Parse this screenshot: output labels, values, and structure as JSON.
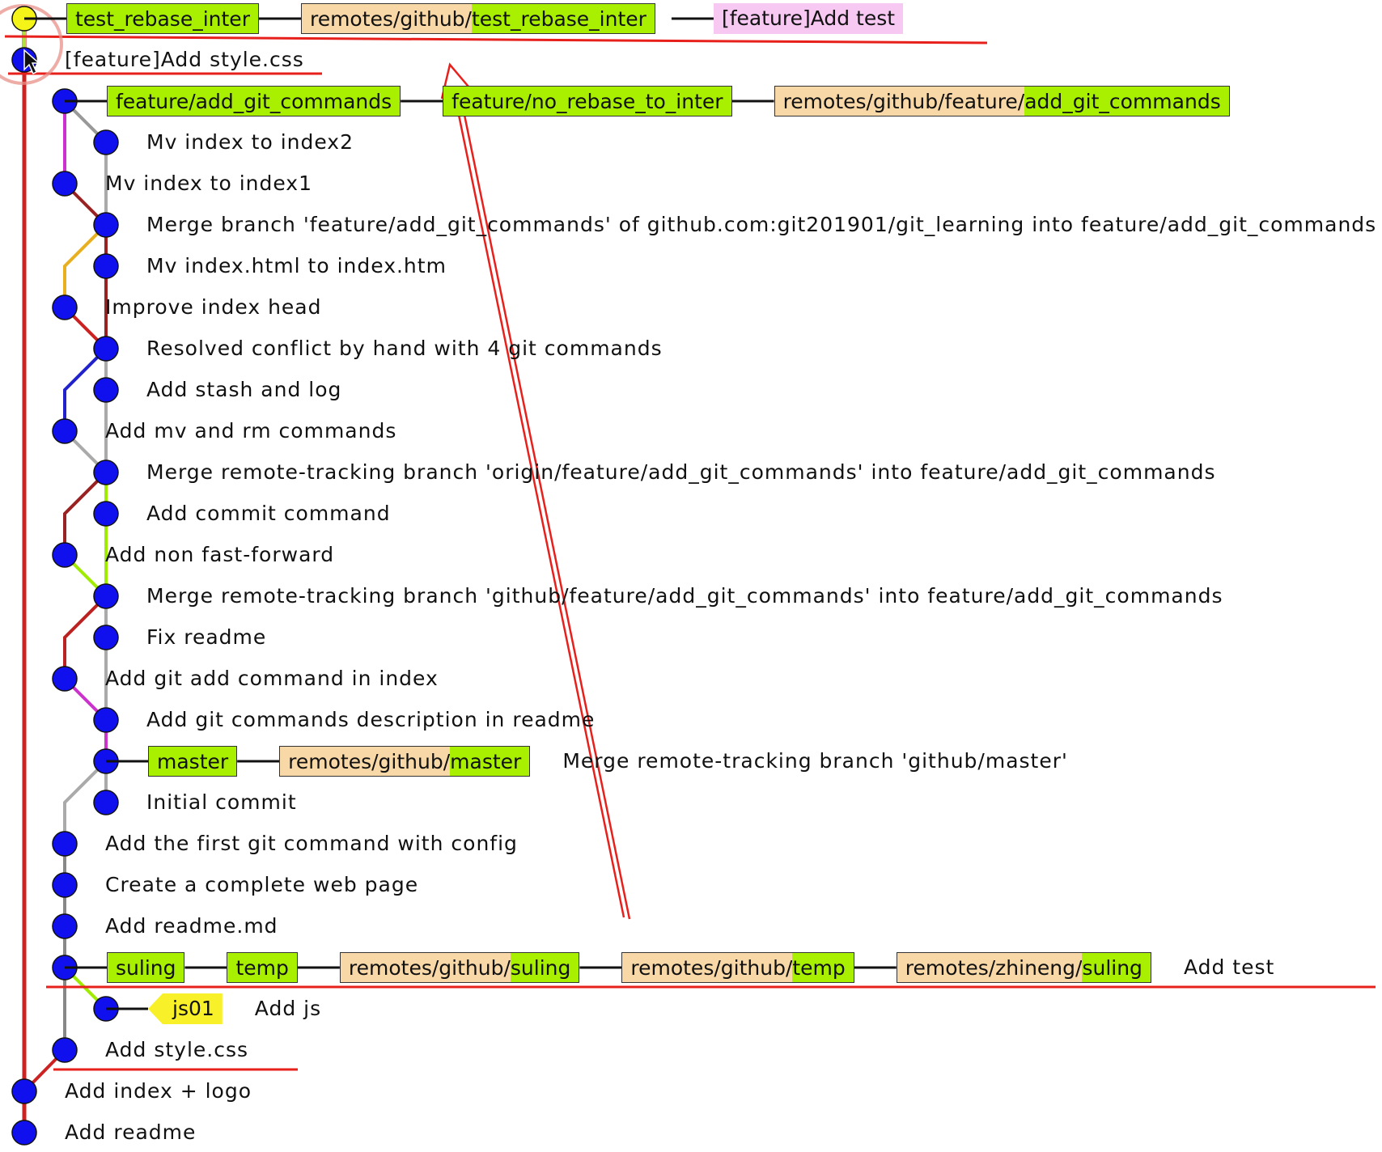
{
  "colors": {
    "node": "#1010ee",
    "node_head": "#f4f418",
    "main_line": "#cc2222",
    "local_branch": "#a8f000",
    "remote_prefix": "#f9d8a8",
    "head_message": "#f6c8f2",
    "tag": "#f8f028",
    "annotation": "#e8201c"
  },
  "commits": [
    {
      "lane": 0,
      "head": true,
      "labels": [
        {
          "kind": "local",
          "text": "test_rebase_inter"
        },
        {
          "kind": "remote",
          "prefix": "remotes/github/",
          "name": "test_rebase_inter"
        },
        {
          "kind": "head-msg",
          "text": "[feature]Add test"
        }
      ],
      "message": ""
    },
    {
      "lane": 0,
      "message": "[feature]Add style.css"
    },
    {
      "lane": 1,
      "labels": [
        {
          "kind": "local",
          "text": "feature/add_git_commands"
        },
        {
          "kind": "local",
          "text": "feature/no_rebase_to_inter"
        },
        {
          "kind": "remote",
          "prefix": "remotes/github/feature/",
          "name": "add_git_commands"
        }
      ],
      "message": ""
    },
    {
      "lane": 2,
      "message": "Mv index to index2"
    },
    {
      "lane": 1,
      "message": "Mv index to index1"
    },
    {
      "lane": 2,
      "message": "Merge branch 'feature/add_git_commands' of github.com:git201901/git_learning into feature/add_git_commands"
    },
    {
      "lane": 2,
      "message": "Mv index.html to index.htm"
    },
    {
      "lane": 1,
      "message": "Improve index head"
    },
    {
      "lane": 2,
      "message": "Resolved conflict by hand with 4 git commands"
    },
    {
      "lane": 2,
      "message": "Add stash and log"
    },
    {
      "lane": 1,
      "message": "Add mv and rm commands"
    },
    {
      "lane": 2,
      "message": "Merge remote-tracking branch 'origin/feature/add_git_commands' into feature/add_git_commands"
    },
    {
      "lane": 2,
      "message": "Add commit command"
    },
    {
      "lane": 1,
      "message": "Add non fast-forward"
    },
    {
      "lane": 2,
      "message": "Merge remote-tracking branch 'github/feature/add_git_commands' into feature/add_git_commands"
    },
    {
      "lane": 2,
      "message": "Fix readme"
    },
    {
      "lane": 1,
      "message": "Add git add command in index"
    },
    {
      "lane": 2,
      "message": "Add git commands description in readme"
    },
    {
      "lane": 2,
      "labels": [
        {
          "kind": "local",
          "text": "master"
        },
        {
          "kind": "remote",
          "prefix": "remotes/github/",
          "name": "master"
        }
      ],
      "message": "Merge remote-tracking branch 'github/master'"
    },
    {
      "lane": 2,
      "message": "Initial commit"
    },
    {
      "lane": 1,
      "message": "Add the first git command with config"
    },
    {
      "lane": 1,
      "message": "Create a complete web page"
    },
    {
      "lane": 1,
      "message": "Add readme.md"
    },
    {
      "lane": 1,
      "labels": [
        {
          "kind": "local",
          "text": "suling"
        },
        {
          "kind": "local",
          "text": "temp"
        },
        {
          "kind": "remote",
          "prefix": "remotes/github/",
          "name": "suling"
        },
        {
          "kind": "remote",
          "prefix": "remotes/github/",
          "name": "temp"
        },
        {
          "kind": "remote",
          "prefix": "remotes/zhineng/",
          "name": "suling"
        }
      ],
      "message": "Add test"
    },
    {
      "lane": 2,
      "labels": [
        {
          "kind": "tag",
          "text": "js01"
        }
      ],
      "message": "Add js"
    },
    {
      "lane": 1,
      "message": "Add style.css"
    },
    {
      "lane": 0,
      "message": "Add index + logo"
    },
    {
      "lane": 0,
      "message": "Add readme"
    }
  ]
}
